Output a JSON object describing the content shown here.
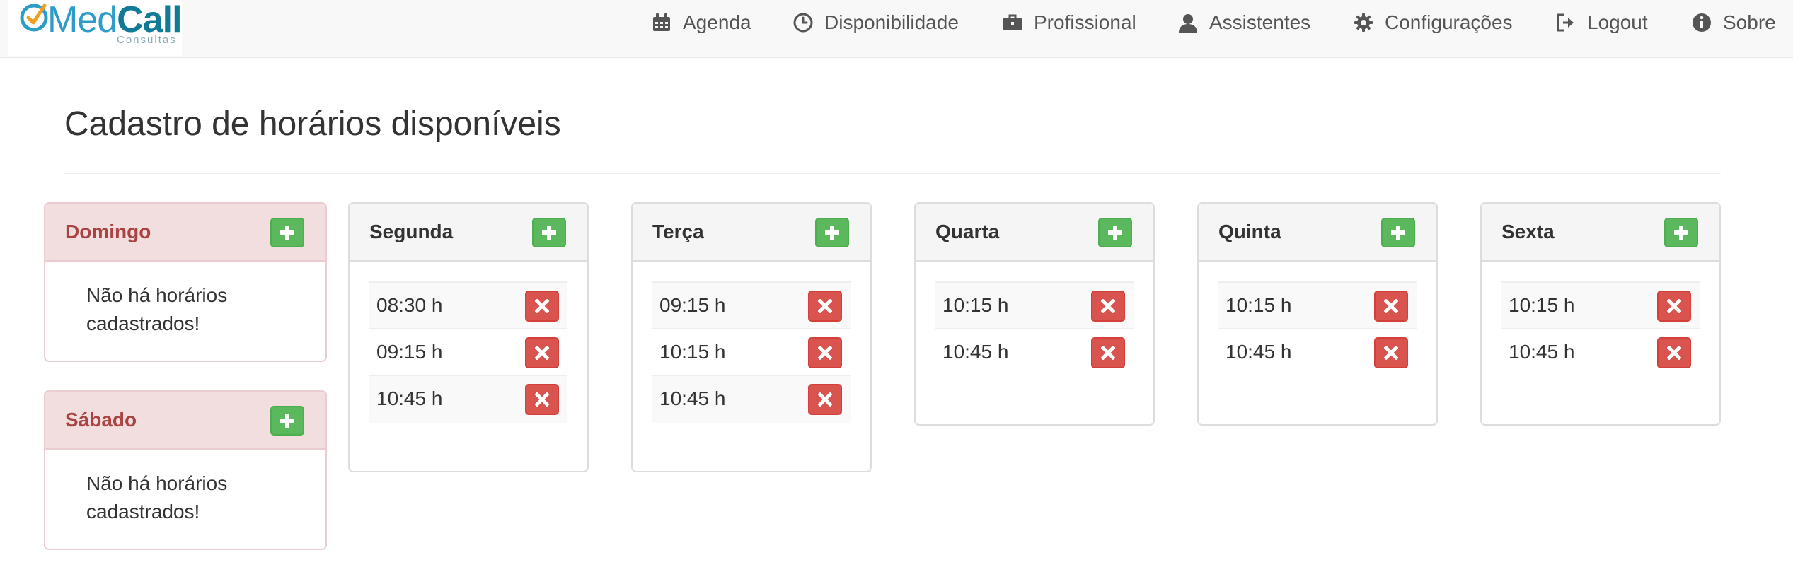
{
  "brand": {
    "name_part1": "Med",
    "name_part2": "Call",
    "subtitle": "Consultas"
  },
  "nav": {
    "agenda": {
      "label": "Agenda",
      "icon": "calendar-icon"
    },
    "disponibilidade": {
      "label": "Disponibilidade",
      "icon": "clock-icon"
    },
    "profissional": {
      "label": "Profissional",
      "icon": "briefcase-icon"
    },
    "assistentes": {
      "label": "Assistentes",
      "icon": "user-icon"
    },
    "configuracoes": {
      "label": "Configurações",
      "icon": "gear-icon"
    },
    "logout": {
      "label": "Logout",
      "icon": "logout-icon"
    },
    "sobre": {
      "label": "Sobre",
      "icon": "info-icon"
    }
  },
  "page": {
    "title": "Cadastro de horários disponíveis"
  },
  "days": {
    "domingo": {
      "name": "Domingo",
      "empty_text": "Não há horários cadastrados!"
    },
    "sabado": {
      "name": "Sábado",
      "empty_text": "Não há horários cadastrados!"
    },
    "segunda": {
      "name": "Segunda",
      "slots": [
        "08:30 h",
        "09:15 h",
        "10:45 h"
      ]
    },
    "terca": {
      "name": "Terça",
      "slots": [
        "09:15 h",
        "10:15 h",
        "10:45 h"
      ]
    },
    "quarta": {
      "name": "Quarta",
      "slots": [
        "10:15 h",
        "10:45 h"
      ]
    },
    "quinta": {
      "name": "Quinta",
      "slots": [
        "10:15 h",
        "10:45 h"
      ]
    },
    "sexta": {
      "name": "Sexta",
      "slots": [
        "10:15 h",
        "10:45 h"
      ]
    }
  },
  "colors": {
    "add_button": "#5cb85c",
    "delete_button": "#d9534f",
    "empty_day_heading": "#f2dede",
    "empty_day_title": "#a94442",
    "brand_primary": "#2e9cc8",
    "brand_dark": "#117a97"
  }
}
